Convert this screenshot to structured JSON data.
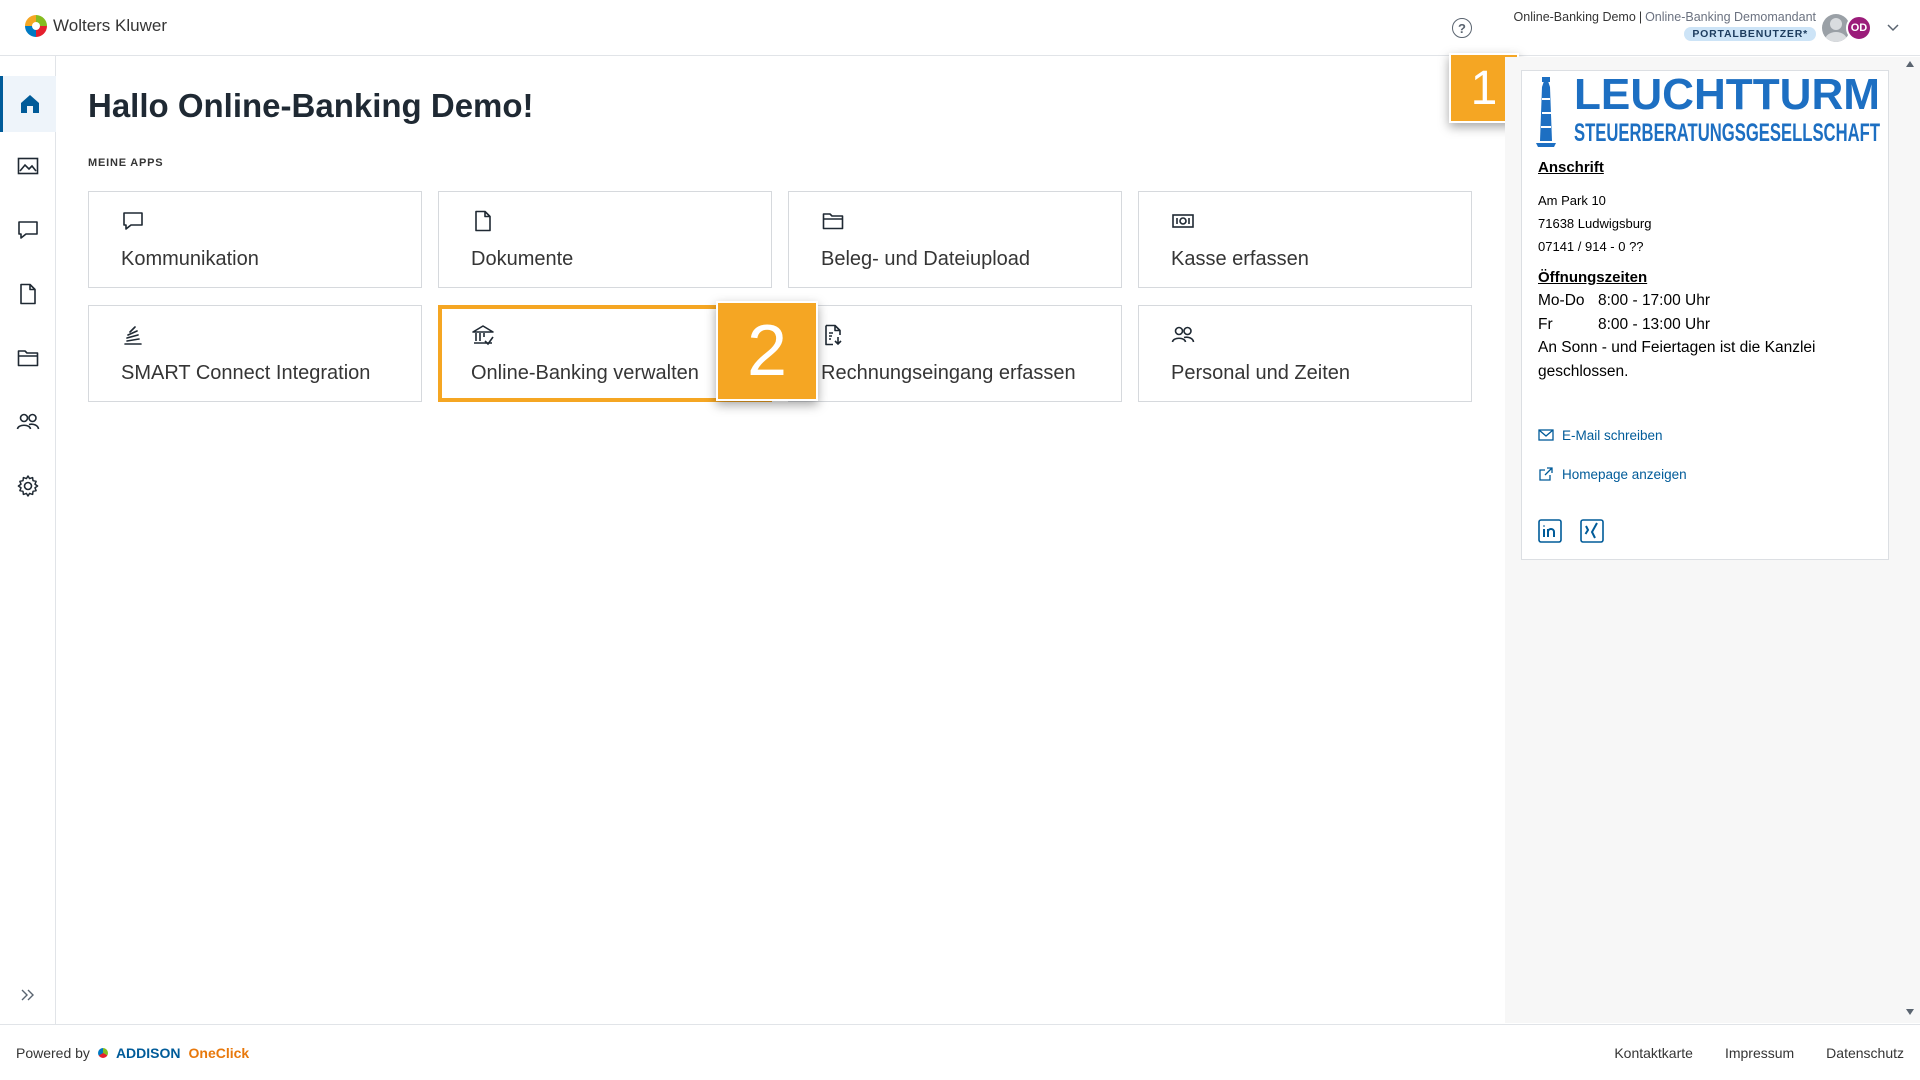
{
  "brand": {
    "name": "Wolters Kluwer"
  },
  "header": {
    "help_label": "?",
    "user_name": "Online-Banking Demo",
    "separator": "|",
    "tenant": "Online-Banking Demomandant",
    "role": "PORTALBENUTZER*",
    "avatar_initials": "OD"
  },
  "sidebar": {
    "items": [
      {
        "name": "home",
        "icon": "home-icon",
        "active": true
      },
      {
        "name": "images",
        "icon": "image-icon"
      },
      {
        "name": "communication",
        "icon": "chat-icon"
      },
      {
        "name": "documents",
        "icon": "document-icon"
      },
      {
        "name": "folders",
        "icon": "folder-icon"
      },
      {
        "name": "people",
        "icon": "people-icon"
      },
      {
        "name": "settings",
        "icon": "gear-icon"
      }
    ]
  },
  "main": {
    "title": "Hallo Online-Banking Demo!",
    "section_label": "MEINE APPS",
    "apps": [
      {
        "label": "Kommunikation",
        "icon": "chat-icon"
      },
      {
        "label": "Dokumente",
        "icon": "document-icon"
      },
      {
        "label": "Beleg- und Dateiupload",
        "icon": "folder-icon"
      },
      {
        "label": "Kasse erfassen",
        "icon": "cash-icon"
      },
      {
        "label": "SMART Connect Integration",
        "icon": "smart-connect-icon"
      },
      {
        "label": "Online-Banking verwalten",
        "icon": "bank-icon",
        "highlighted": true
      },
      {
        "label": "Rechnungseingang erfassen",
        "icon": "invoice-icon"
      },
      {
        "label": "Personal und Zeiten",
        "icon": "people-icon"
      }
    ]
  },
  "callouts": {
    "first": "1",
    "second": "2"
  },
  "office": {
    "logo_title": "LEUCHTTURM",
    "logo_subtitle": "STEUERBERATUNGSGESELLSCHAFT",
    "address_heading": "Anschrift",
    "street": "Am Park 10",
    "city": "71638 Ludwigsburg",
    "phone": "07141 / 914 - 0 ??",
    "hours_heading": "Öffnungszeiten",
    "hours": [
      {
        "days": "Mo-Do",
        "time": "8:00 - 17:00 Uhr"
      },
      {
        "days": "Fr",
        "time": "8:00 - 13:00 Uhr"
      }
    ],
    "holiday_note_1": "An Sonn - und Feiertagen ist die Kanzlei",
    "holiday_note_2": "geschlossen.",
    "email_link": "E-Mail schreiben",
    "homepage_link": "Homepage anzeigen",
    "social": [
      "linkedin-icon",
      "xing-icon"
    ]
  },
  "footer": {
    "powered_by": "Powered by",
    "product_brand": "ADDISON",
    "product_name": "OneClick",
    "links": [
      "Kontaktkarte",
      "Impressum",
      "Datenschutz"
    ]
  },
  "colors": {
    "accent": "#005b99",
    "callout": "#f5a623",
    "avatar": "#9b1c7a",
    "logo_blue": "#1d6fc2"
  }
}
